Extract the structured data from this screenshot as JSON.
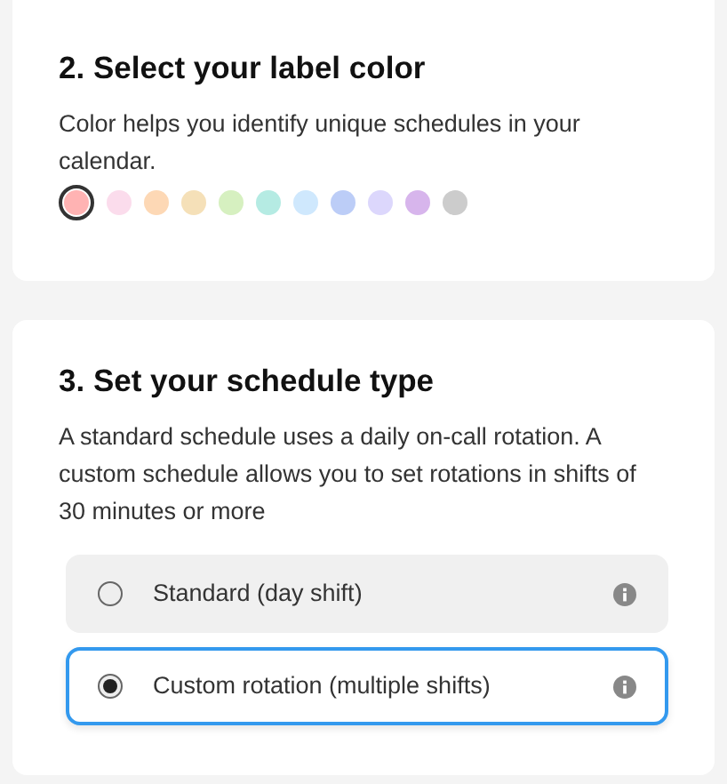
{
  "label_section": {
    "title": "2. Select your label color",
    "description": "Color helps you identify unique schedules in your calendar.",
    "colors": [
      {
        "color": "#ffb3b3",
        "selected": true
      },
      {
        "color": "#fbdcec",
        "selected": false
      },
      {
        "color": "#fdd8b5",
        "selected": false
      },
      {
        "color": "#f5e0b8",
        "selected": false
      },
      {
        "color": "#d6f0c0",
        "selected": false
      },
      {
        "color": "#b5ebe3",
        "selected": false
      },
      {
        "color": "#cfe8fd",
        "selected": false
      },
      {
        "color": "#bccdf7",
        "selected": false
      },
      {
        "color": "#dcd7fc",
        "selected": false
      },
      {
        "color": "#d7b5ec",
        "selected": false
      },
      {
        "color": "#cccccc",
        "selected": false
      }
    ]
  },
  "schedule_section": {
    "title": "3. Set your schedule type",
    "description": "A standard schedule uses a daily on-call rotation. A custom schedule allows you to set rotations in shifts of 30 minutes or more",
    "options": [
      {
        "label": "Standard (day shift)",
        "selected": false
      },
      {
        "label": "Custom rotation (multiple shifts)",
        "selected": true
      }
    ]
  }
}
